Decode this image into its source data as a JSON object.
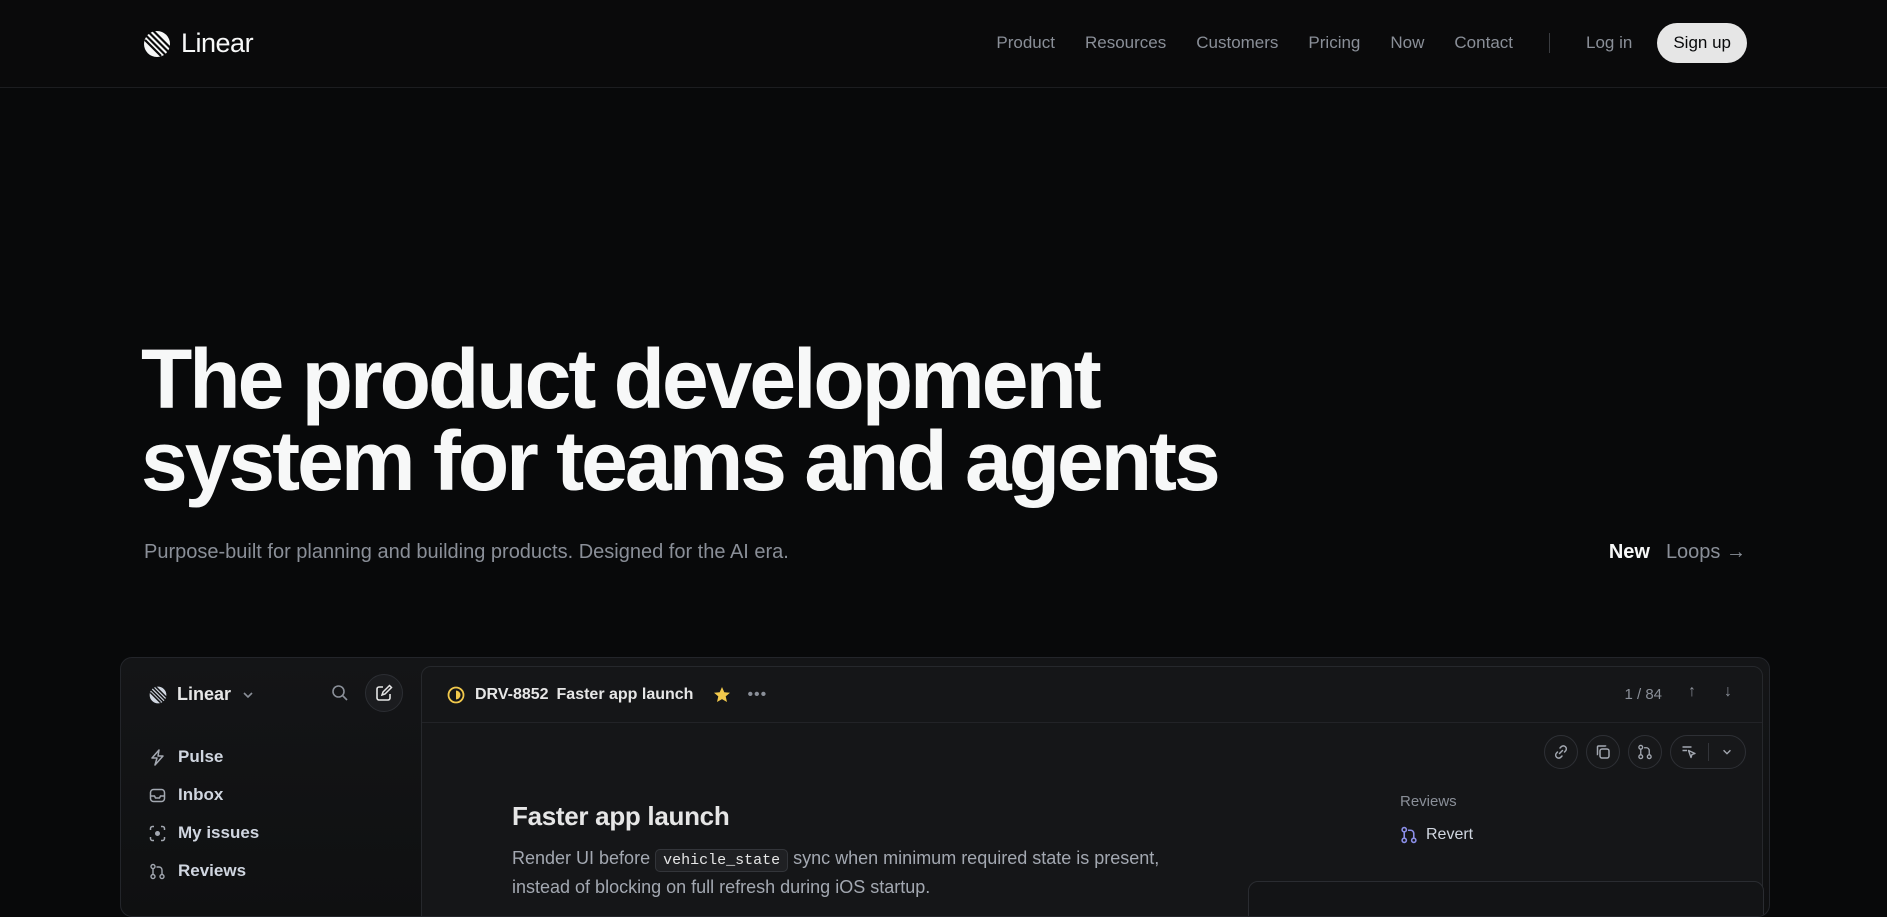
{
  "nav": {
    "brand": "Linear",
    "links": [
      "Product",
      "Resources",
      "Customers",
      "Pricing",
      "Now",
      "Contact"
    ],
    "login": "Log in",
    "signup": "Sign up"
  },
  "hero": {
    "title_line1": "The product development",
    "title_line2": "system for teams and agents",
    "subtitle": "Purpose-built for planning and building products. Designed for the AI era.",
    "new_label": "New",
    "new_link": "Loops →"
  },
  "app": {
    "workspace": "Linear",
    "sidebar_items": [
      {
        "label": "Pulse",
        "icon": "pulse-icon"
      },
      {
        "label": "Inbox",
        "icon": "inbox-icon"
      },
      {
        "label": "My issues",
        "icon": "my-issues-icon"
      },
      {
        "label": "Reviews",
        "icon": "reviews-icon"
      }
    ],
    "issue": {
      "id": "DRV-8852",
      "header_title": "Faster app launch",
      "pager": "1 / 84",
      "title": "Faster app launch",
      "desc_before": "Render UI before",
      "desc_code": "vehicle_state",
      "desc_after": "sync when minimum required state is present, instead of blocking on full refresh during iOS startup."
    },
    "reviews": {
      "label": "Reviews",
      "item": "Revert"
    }
  },
  "colors": {
    "background": "#08090a",
    "accent_star": "#f2c94c",
    "status_in_progress": "#f2c94c",
    "review_icon": "#8b8fe8"
  }
}
